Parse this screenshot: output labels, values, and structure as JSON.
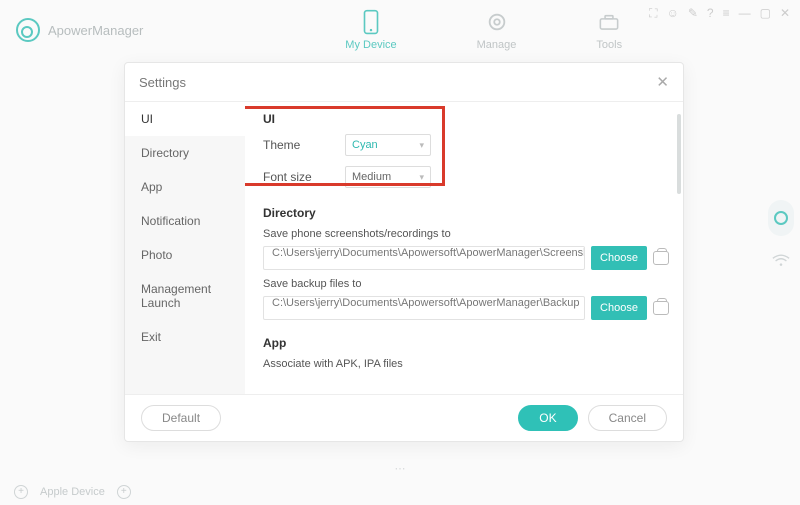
{
  "app": {
    "name": "ApowerManager"
  },
  "nav": {
    "my_device": "My Device",
    "manage": "Manage",
    "tools": "Tools"
  },
  "modal": {
    "title": "Settings",
    "sidebar": {
      "ui": "UI",
      "directory": "Directory",
      "app": "App",
      "notification": "Notification",
      "photo": "Photo",
      "mgmt": "Management Launch",
      "exit": "Exit"
    },
    "ui_section": {
      "heading": "UI",
      "theme_label": "Theme",
      "theme_value": "Cyan",
      "font_label": "Font size",
      "font_value": "Medium"
    },
    "dir_section": {
      "heading": "Directory",
      "screenshots_label": "Save phone screenshots/recordings to",
      "screenshots_path": "C:\\Users\\jerry\\Documents\\Apowersoft\\ApowerManager\\Screensho",
      "backup_label": "Save backup files to",
      "backup_path": "C:\\Users\\jerry\\Documents\\Apowersoft\\ApowerManager\\Backup",
      "choose": "Choose"
    },
    "app_section": {
      "heading": "App",
      "assoc_label": "Associate with APK, IPA files"
    },
    "buttons": {
      "default": "Default",
      "ok": "OK",
      "cancel": "Cancel"
    }
  },
  "bottom": {
    "device": "Apple Device"
  }
}
